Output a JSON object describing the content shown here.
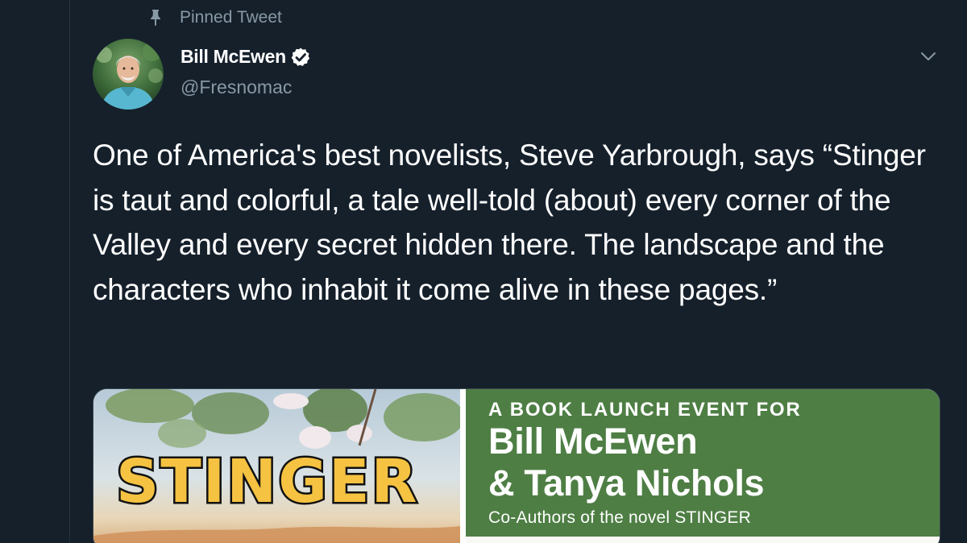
{
  "pinned": {
    "label": "Pinned Tweet",
    "icon": "pin-icon"
  },
  "author": {
    "name": "Bill McEwen",
    "handle": "@Fresnomac",
    "verified_icon": "verified-badge-icon",
    "avatar_icon": "avatar-photo"
  },
  "menu": {
    "icon": "chevron-down-icon"
  },
  "tweet": {
    "text": "One of America's best novelists, Steve Yarbrough, says “Stinger is taut and colorful, a tale well-told (about) every corner of the Valley and every secret hidden there. The landscape and the characters who inhabit it come alive in these pages.”"
  },
  "media": {
    "cover_title": "STINGER",
    "event_kicker": "A BOOK LAUNCH EVENT FOR",
    "event_name_line1": "Bill McEwen",
    "event_name_line2": "& Tanya Nichols",
    "event_sub": "Co-Authors of the novel STINGER"
  },
  "colors": {
    "background": "#15202b",
    "secondary_text": "#8899a6",
    "primary_text": "#ffffff",
    "event_panel_green": "#4e7e44",
    "cover_title_yellow": "#f5c242"
  }
}
